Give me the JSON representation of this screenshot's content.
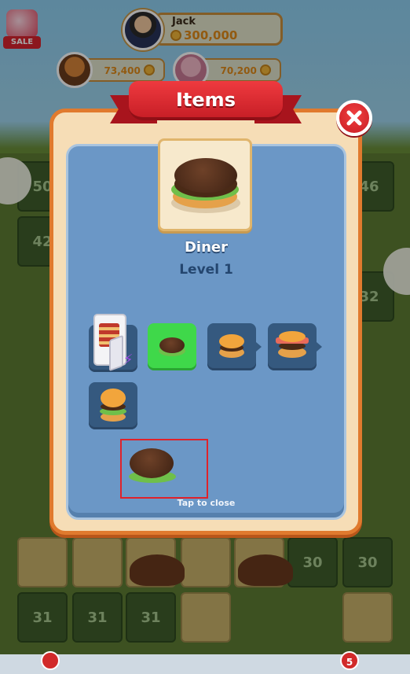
{
  "hud": {
    "sale_label": "SALE",
    "player": {
      "name": "Jack",
      "coins": "300,000"
    },
    "rivals": [
      {
        "coins": "73,400"
      },
      {
        "coins": "70,200"
      }
    ]
  },
  "board": {
    "tile_numbers": [
      "50",
      "46",
      "42",
      "30",
      "30",
      "31",
      "31",
      "31",
      "32"
    ]
  },
  "modal": {
    "title": "Items",
    "item_name": "Diner",
    "item_level": "Level 1",
    "tap_to_close": "Tap to close",
    "chain": [
      {
        "name": "Refrigerator",
        "icon": "fridge-icon"
      },
      {
        "name": "Patty",
        "icon": "patty-icon",
        "current": true
      },
      {
        "name": "Small burger",
        "icon": "small-burger-icon"
      },
      {
        "name": "Bacon burger",
        "icon": "bacon-burger-icon"
      },
      {
        "name": "Big burger",
        "icon": "big-burger-icon"
      }
    ]
  },
  "bottom": {
    "badge_count": "5"
  },
  "colors": {
    "ribbon": "#d3242c",
    "panel": "#6b97c6",
    "frame": "#e07a2e",
    "current_slot": "#3fd84a"
  }
}
